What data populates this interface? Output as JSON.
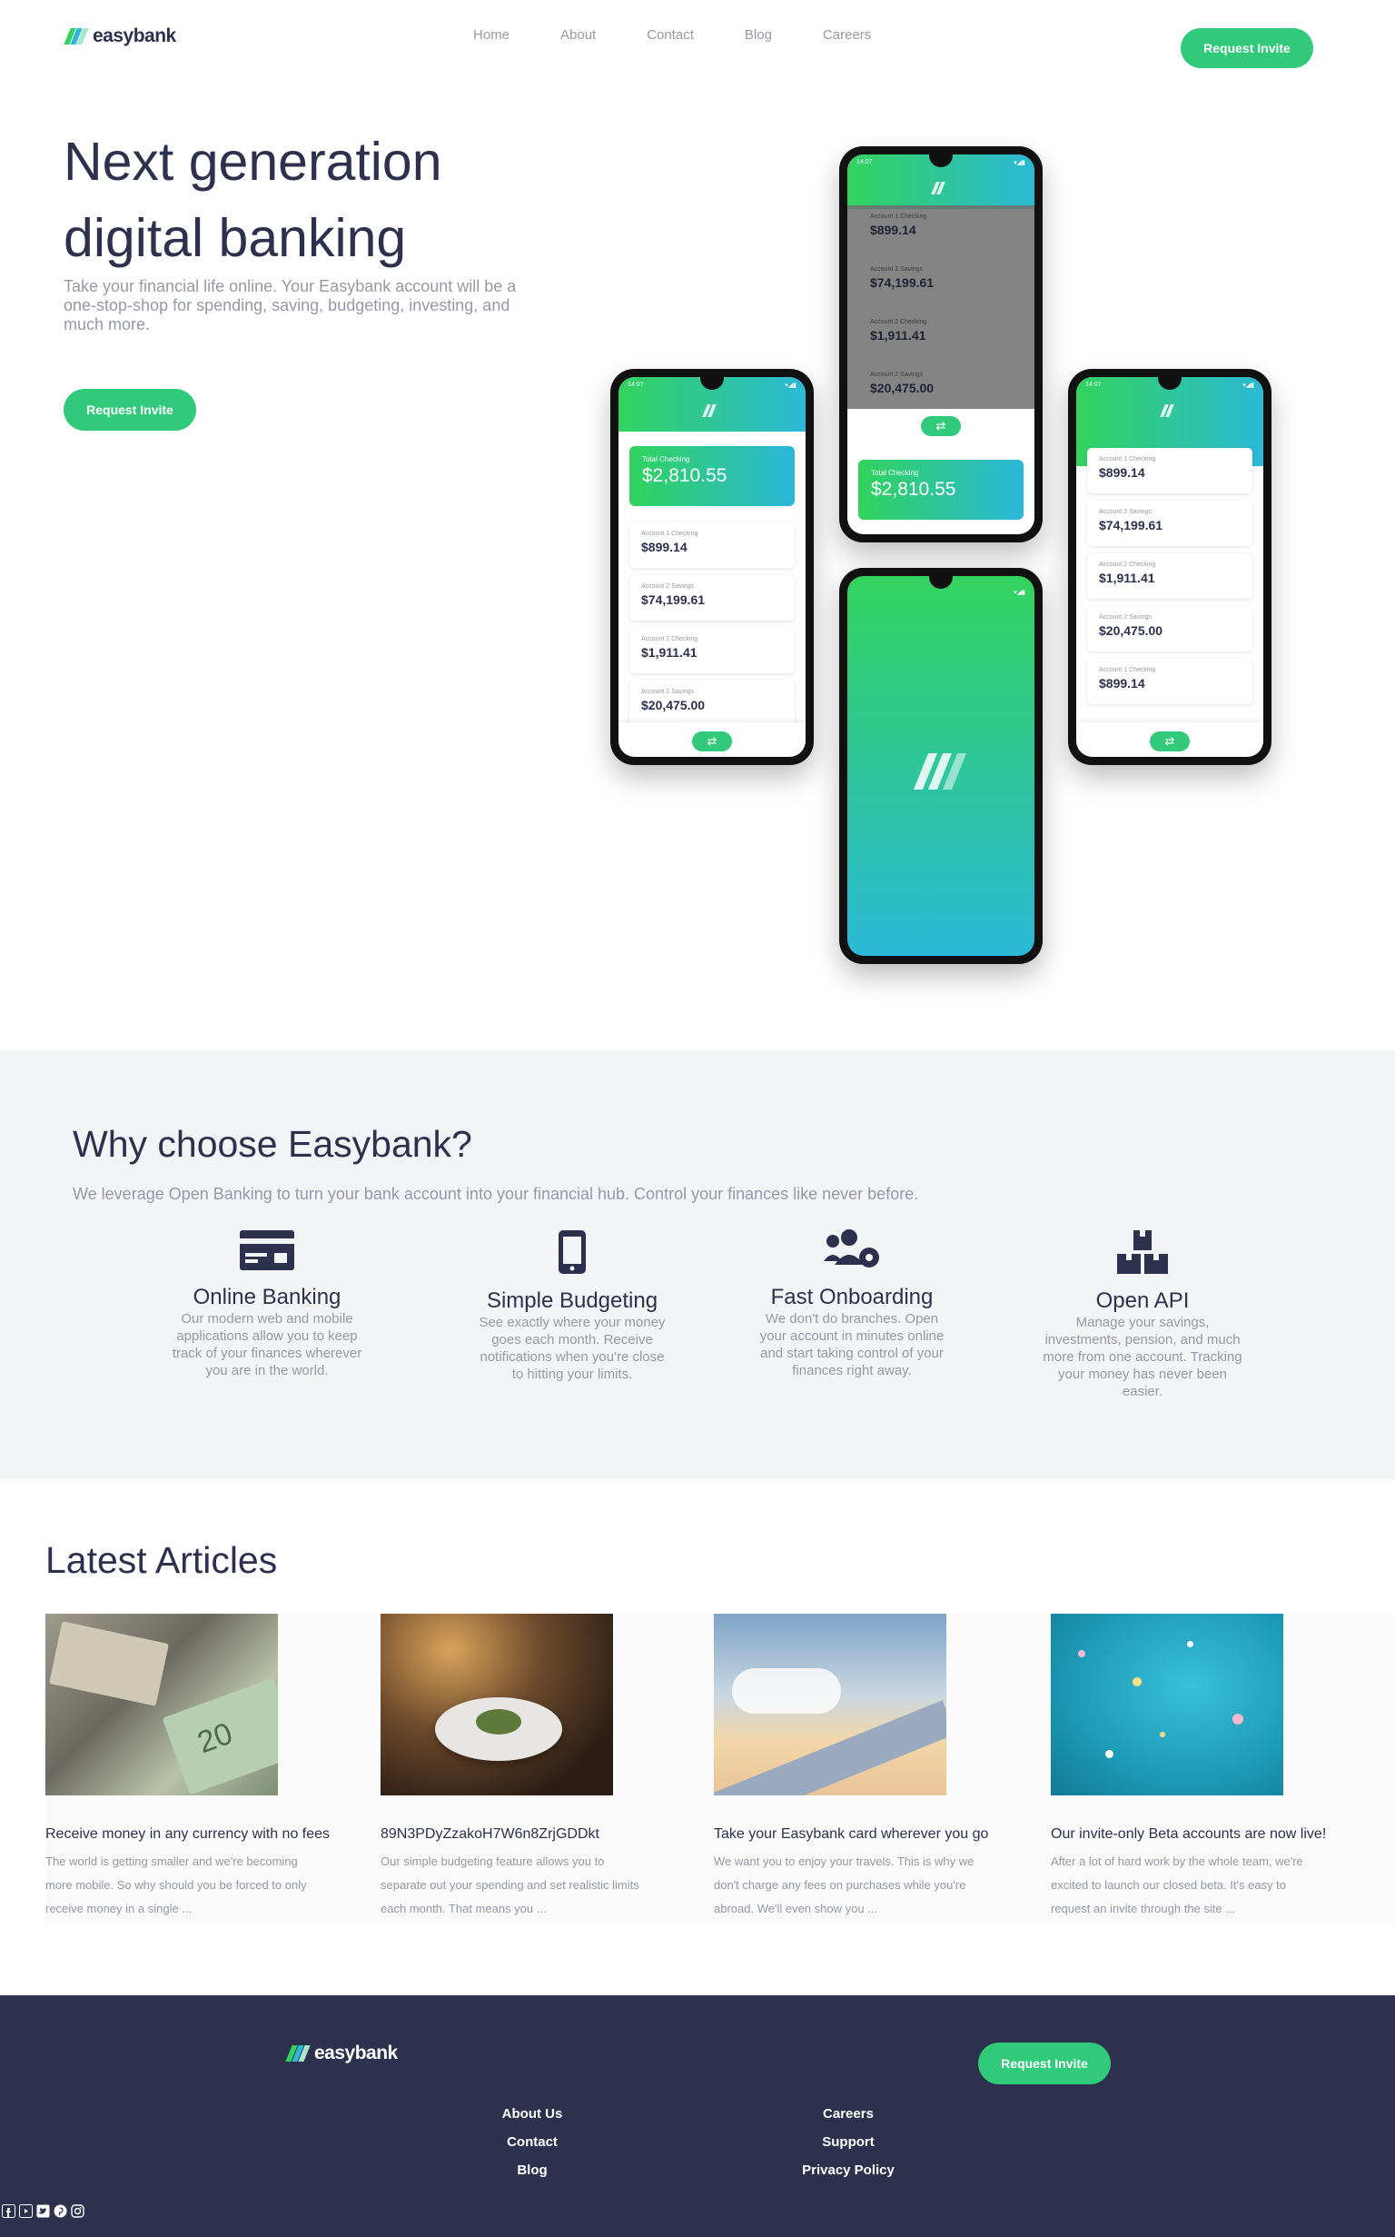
{
  "header": {
    "logo_text": "easybank",
    "nav": [
      "Home",
      "About",
      "Contact",
      "Blog",
      "Careers"
    ],
    "cta": "Request Invite"
  },
  "hero": {
    "title_line1": "Next generation",
    "title_line2": "digital banking",
    "subtitle": "Take your financial life online. Your Easybank account will be a one-stop-shop for spending, saving, budgeting, investing, and much more.",
    "cta": "Request Invite"
  },
  "phones": {
    "status_time": "14:07",
    "total_label": "Total Checking",
    "total_amount": "$2,810.55",
    "accounts": [
      {
        "label": "Account 1 Checking",
        "amount": "$899.14"
      },
      {
        "label": "Account 2 Savings",
        "amount": "$74,199.61"
      },
      {
        "label": "Account 2 Checking",
        "amount": "$1,911.41"
      },
      {
        "label": "Account 2 Savings",
        "amount": "$20,475.00"
      },
      {
        "label": "Account 1 Checking",
        "amount": "$899.14"
      }
    ],
    "fab_symbol": "⇄"
  },
  "why": {
    "title": "Why choose Easybank?",
    "subtitle": "We leverage Open Banking to turn your bank account into your financial hub. Control your finances like never before.",
    "features": [
      {
        "icon": "credit-card-icon",
        "title": "Online Banking",
        "text": "Our modern web and mobile applications allow you to keep track of your finances wherever you are in the world."
      },
      {
        "icon": "mobile-phone-icon",
        "title": "Simple Budgeting",
        "text": "See exactly where your money goes each month. Receive notifications when you're close to hitting your limits."
      },
      {
        "icon": "users-cog-icon",
        "title": "Fast Onboarding",
        "text": "We don't do branches. Open your account in minutes online and start taking control of your finances right away."
      },
      {
        "icon": "boxes-icon",
        "title": "Open API",
        "text": "Manage your savings, investments, pension, and much more from one account. Tracking your money has never been easier."
      }
    ]
  },
  "articles": {
    "title": "Latest Articles",
    "items": [
      {
        "image": "currency-photo",
        "title": "Receive money in any currency with no fees",
        "excerpt": "The world is getting smaller and we're becoming more mobile. So why should you be forced to only receive money in a single ..."
      },
      {
        "image": "restaurant-photo",
        "title": "89N3PDyZzakoH7W6n8ZrjGDDkt",
        "excerpt": "Our simple budgeting feature allows you to separate out your spending and set realistic limits each month. That means you ..."
      },
      {
        "image": "airplane-wing-photo",
        "title": "Take your Easybank card wherever you go",
        "excerpt": "We want you to enjoy your travels. This is why we don't charge any fees on purchases while you're abroad. We'll even show you ..."
      },
      {
        "image": "confetti-photo",
        "title": "Our invite-only Beta accounts are now live!",
        "excerpt": "After a lot of hard work by the whole team, we're excited to launch our closed beta. It's easy to request an invite through the site ..."
      }
    ]
  },
  "footer": {
    "logo_text": "easybank",
    "cta": "Request Invite",
    "links_left": [
      "About Us",
      "Contact",
      "Blog"
    ],
    "links_right": [
      "Careers",
      "Support",
      "Privacy Policy"
    ],
    "social": [
      "facebook-icon",
      "youtube-icon",
      "twitter-icon",
      "pinterest-icon",
      "instagram-icon"
    ]
  },
  "colors": {
    "primary": "#31c97a",
    "accent_gradient_start": "#33d35e",
    "accent_gradient_end": "#2bb9d6",
    "dark_blue": "#2d314d",
    "grayish_blue": "#9698a6",
    "light_gray": "#f3f4f6"
  }
}
